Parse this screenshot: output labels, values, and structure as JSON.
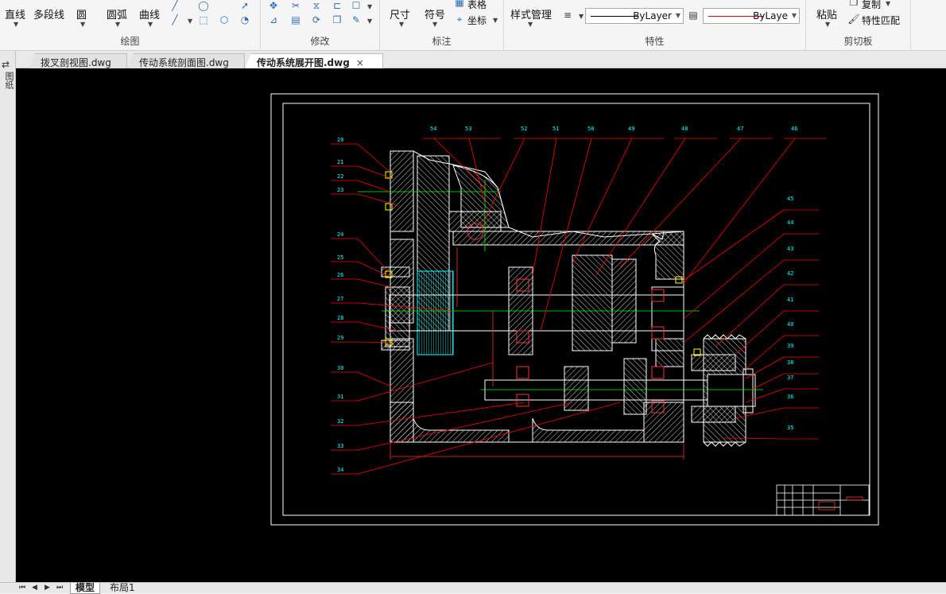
{
  "ribbon": {
    "draw": {
      "label": "绘图",
      "items": [
        "直线",
        "多段线",
        "圆",
        "圆弧",
        "曲线"
      ]
    },
    "modify": {
      "label": "修改"
    },
    "annotate": {
      "label": "标注",
      "items": [
        "尺寸",
        "符号"
      ],
      "table": "表格",
      "coord": "坐标"
    },
    "properties": {
      "label": "特性",
      "style_manager": "样式管理",
      "linetype": "ByLayer",
      "color": "ByLaye"
    },
    "clipboard": {
      "label": "剪切板",
      "paste": "粘贴",
      "copy": "复制",
      "match": "特性匹配"
    }
  },
  "tabs": [
    {
      "label": "拨叉剖视图.dwg",
      "active": false
    },
    {
      "label": "传动系统剖面图.dwg",
      "active": false
    },
    {
      "label": "传动系统展开图.dwg",
      "active": true,
      "close": "×"
    }
  ],
  "sidebar": {
    "label": "图纸"
  },
  "bottom_tabs": [
    "模型",
    "布局1"
  ],
  "drawing": {
    "callouts_top": [
      "54",
      "53",
      "52",
      "51",
      "50",
      "49",
      "48",
      "47",
      "46"
    ],
    "callouts_left": [
      "20",
      "21",
      "22",
      "23",
      "24",
      "25",
      "26",
      "27",
      "28",
      "29",
      "30",
      "31",
      "32",
      "33",
      "34"
    ],
    "callouts_right": [
      "45",
      "44",
      "43",
      "42",
      "41",
      "40",
      "39",
      "38",
      "37",
      "36",
      "35"
    ],
    "colors": {
      "background": "#000000",
      "frame": "#ffffff",
      "leader": "#ff0000",
      "label": "#00ffff",
      "hatch": "#ffffff",
      "centerline": "#00ff00",
      "accent": "#ffff00"
    }
  }
}
